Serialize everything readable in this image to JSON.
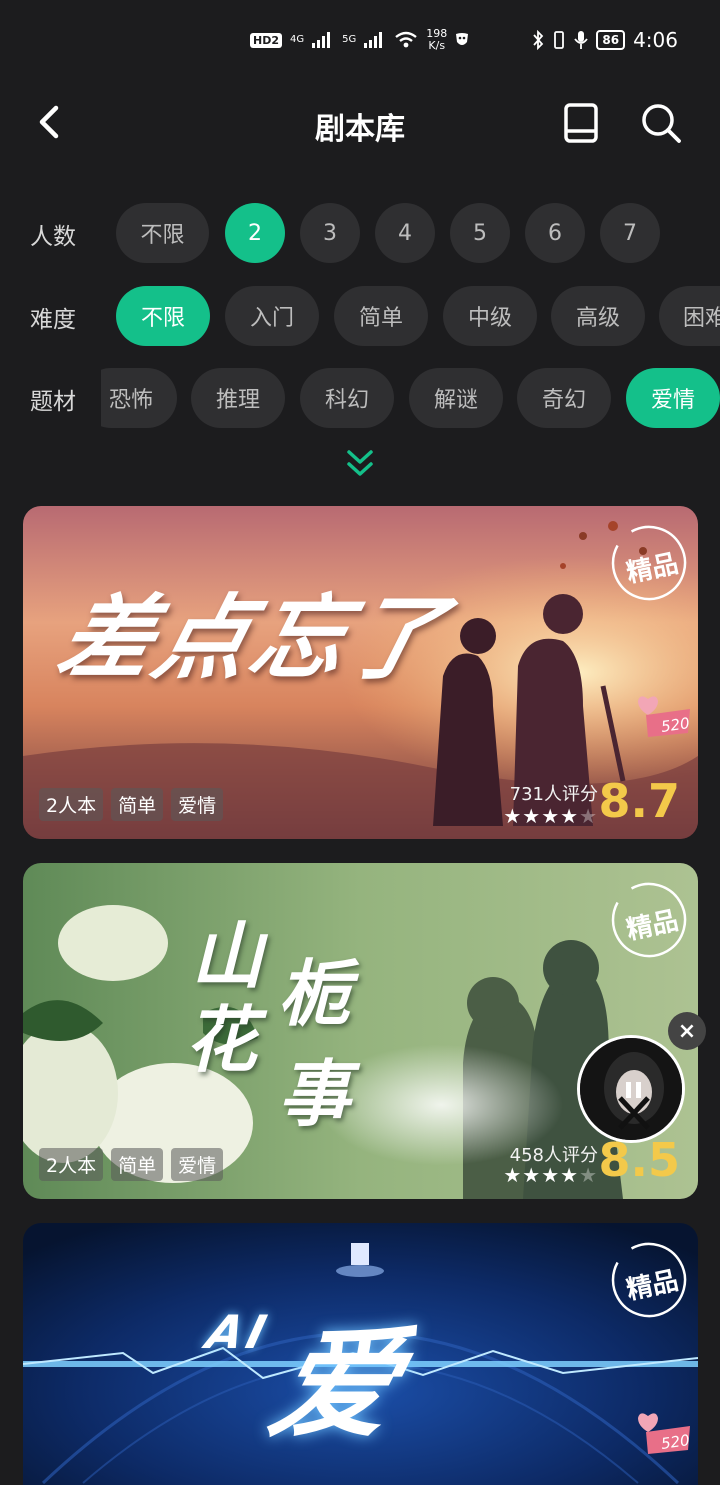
{
  "status_bar": {
    "hd": "HD",
    "hd_num": "2",
    "net1": "4G",
    "net2": "5G",
    "speed_value": "198",
    "speed_unit": "K/s",
    "battery": "86",
    "time": "4:06"
  },
  "header": {
    "title": "剧本库",
    "icons": [
      "back-icon",
      "book-icon",
      "search-icon"
    ]
  },
  "filters": {
    "players": {
      "label": "人数",
      "options": [
        "不限",
        "2",
        "3",
        "4",
        "5",
        "6",
        "7"
      ],
      "selected": "2"
    },
    "difficulty": {
      "label": "难度",
      "options": [
        "不限",
        "入门",
        "简单",
        "中级",
        "高级",
        "困难"
      ],
      "selected": "不限"
    },
    "genre": {
      "label": "题材",
      "options": [
        "恐怖",
        "推理",
        "科幻",
        "解谜",
        "奇幻",
        "爱情"
      ],
      "selected": "爱情"
    }
  },
  "colors": {
    "accent": "#14c08a",
    "background": "#1c1c1e",
    "chip": "#2f2f31",
    "score": "#f3c94a"
  },
  "cards": [
    {
      "title": "差点忘了",
      "badge": "精品",
      "heart_label": "520",
      "tags": [
        "2人本",
        "简单",
        "爱情"
      ],
      "raters": "731人评分",
      "stars_filled": 4,
      "stars_total": 5,
      "score": "8.7"
    },
    {
      "title_a": "山",
      "title_b": "栀",
      "title_c": "花",
      "title_d": "事",
      "badge": "精品",
      "tags": [
        "2人本",
        "简单",
        "爱情"
      ],
      "raters": "458人评分",
      "stars_filled": 4,
      "stars_total": 5,
      "score": "8.5"
    },
    {
      "title_small": "AI",
      "title_big": "爱",
      "badge": "精品",
      "heart_label": "520"
    }
  ],
  "floating": {
    "close": "×"
  }
}
